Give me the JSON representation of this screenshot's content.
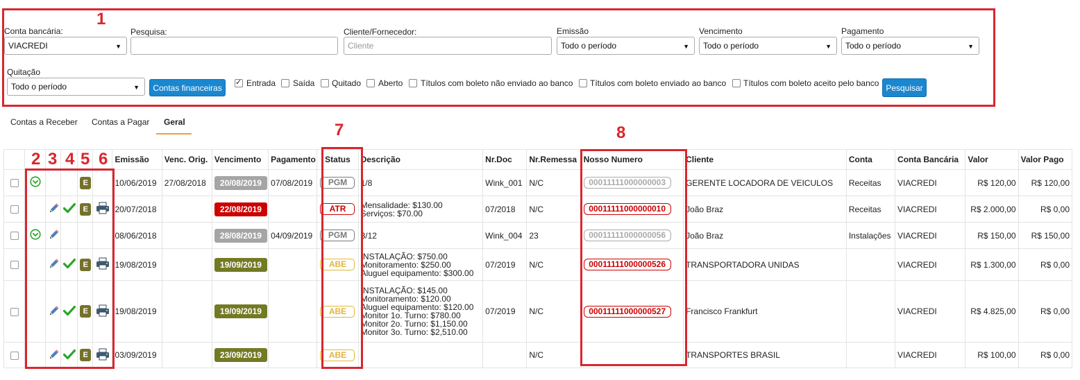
{
  "filters": {
    "conta_bancaria": {
      "label": "Conta bancária:",
      "value": "VIACREDI"
    },
    "pesquisa": {
      "label": "Pesquisa:",
      "value": ""
    },
    "cliente": {
      "label": "Cliente/Fornecedor:",
      "placeholder": "Cliente"
    },
    "emissao": {
      "label": "Emissão",
      "value": "Todo o período"
    },
    "vencimento": {
      "label": "Vencimento",
      "value": "Todo o período"
    },
    "pagamento": {
      "label": "Pagamento",
      "value": "Todo o período"
    },
    "quitacao": {
      "label": "Quitação",
      "value": "Todo o período"
    },
    "contas_financeiras_btn": "Contas financeiras",
    "checkboxes": [
      {
        "label": "Entrada",
        "checked": true
      },
      {
        "label": "Saída",
        "checked": false
      },
      {
        "label": "Quitado",
        "checked": false
      },
      {
        "label": "Aberto",
        "checked": false
      },
      {
        "label": "Títulos com boleto não enviado ao banco",
        "checked": false
      },
      {
        "label": "Títulos com boleto enviado ao banco",
        "checked": false
      },
      {
        "label": "Títulos com boleto aceito pelo banco",
        "checked": false
      }
    ],
    "pesquisar_btn": "Pesquisar"
  },
  "tabs": [
    {
      "label": "Contas a Receber",
      "active": false
    },
    {
      "label": "Contas a Pagar",
      "active": false
    },
    {
      "label": "Geral",
      "active": true
    }
  ],
  "table": {
    "headers": [
      "Emissão",
      "Venc. Orig.",
      "Vencimento",
      "Pagamento",
      "Status",
      "Descrição",
      "Nr.Doc",
      "Nr.Remessa",
      "Nosso Numero",
      "Cliente",
      "Conta",
      "Conta Bancária",
      "Valor",
      "Valor Pago"
    ],
    "rows": [
      {
        "icons": {
          "check_circle": true,
          "edit": false,
          "confirm": false,
          "e": true,
          "print": false
        },
        "emissao": "10/06/2019",
        "venc_orig": "27/08/2018",
        "vencimento": "20/08/2019",
        "venc_color": "#a5a5a5",
        "pagamento": "07/08/2019",
        "status": "PGM",
        "status_color": "#7a7a7a",
        "descricao": [
          "1/8"
        ],
        "nr_doc": "Wink_001",
        "nr_remessa": "N/C",
        "nosso": "00011111000000003",
        "nosso_color": "#aaaaaa",
        "cliente": "GERENTE LOCADORA DE VEICULOS",
        "conta": "Receitas",
        "conta_bancaria": "VIACREDI",
        "valor": "R$ 120,00",
        "valor_pago": "R$ 120,00"
      },
      {
        "icons": {
          "check_circle": false,
          "edit": true,
          "confirm": true,
          "e": true,
          "print": true
        },
        "emissao": "20/07/2018",
        "venc_orig": "",
        "vencimento": "22/08/2019",
        "venc_color": "#cc0000",
        "pagamento": "",
        "status": "ATR",
        "status_color": "#cc0000",
        "descricao": [
          "Mensalidade: $130.00",
          "Serviços: $70.00"
        ],
        "nr_doc": "07/2018",
        "nr_remessa": "N/C",
        "nosso": "00011111000000010",
        "nosso_color": "#cc0000",
        "cliente": "João Braz",
        "conta": "Receitas",
        "conta_bancaria": "VIACREDI",
        "valor": "R$ 2.000,00",
        "valor_pago": "R$ 0,00"
      },
      {
        "icons": {
          "check_circle": true,
          "edit": true,
          "confirm": false,
          "e": false,
          "print": false
        },
        "emissao": "08/06/2018",
        "venc_orig": "",
        "vencimento": "28/08/2019",
        "venc_color": "#a5a5a5",
        "pagamento": "04/09/2019",
        "status": "PGM",
        "status_color": "#7a7a7a",
        "descricao": [
          "3/12"
        ],
        "nr_doc": "Wink_004",
        "nr_remessa": "23",
        "nosso": "00011111000000056",
        "nosso_color": "#aaaaaa",
        "cliente": "João Braz",
        "conta": "Instalações",
        "conta_bancaria": "VIACREDI",
        "valor": "R$ 150,00",
        "valor_pago": "R$ 150,00"
      },
      {
        "icons": {
          "check_circle": false,
          "edit": true,
          "confirm": true,
          "e": true,
          "print": true
        },
        "emissao": "19/08/2019",
        "venc_orig": "",
        "vencimento": "19/09/2019",
        "venc_color": "#737a24",
        "pagamento": "",
        "status": "ABE",
        "status_color": "#e2b53a",
        "descricao": [
          "INSTALAÇÃO: $750.00",
          "Monitoramento: $250.00",
          "Aluguel equipamento: $300.00"
        ],
        "nr_doc": "07/2019",
        "nr_remessa": "N/C",
        "nosso": "00011111000000526",
        "nosso_color": "#cc0000",
        "cliente": "TRANSPORTADORA UNIDAS",
        "conta": "",
        "conta_bancaria": "VIACREDI",
        "valor": "R$ 1.300,00",
        "valor_pago": "R$ 0,00"
      },
      {
        "icons": {
          "check_circle": false,
          "edit": true,
          "confirm": true,
          "e": true,
          "print": true
        },
        "emissao": "19/08/2019",
        "venc_orig": "",
        "vencimento": "19/09/2019",
        "venc_color": "#737a24",
        "pagamento": "",
        "status": "ABE",
        "status_color": "#e2b53a",
        "descricao": [
          "INSTALAÇÃO: $145.00",
          "Monitoramento: $120.00",
          "Aluguel equipamento: $120.00",
          "Monitor 1o. Turno: $780.00",
          "Monitor 2o. Turno: $1,150.00",
          "Monitor 3o. Turno: $2,510.00"
        ],
        "nr_doc": "07/2019",
        "nr_remessa": "N/C",
        "nosso": "00011111000000527",
        "nosso_color": "#cc0000",
        "cliente": "Francisco Frankfurt",
        "conta": "",
        "conta_bancaria": "VIACREDI",
        "valor": "R$ 4.825,00",
        "valor_pago": "R$ 0,00"
      },
      {
        "icons": {
          "check_circle": false,
          "edit": true,
          "confirm": true,
          "e": true,
          "print": true
        },
        "emissao": "03/09/2019",
        "venc_orig": "",
        "vencimento": "23/09/2019",
        "venc_color": "#737a24",
        "pagamento": "",
        "status": "ABE",
        "status_color": "#e2b53a",
        "descricao": [],
        "nr_doc": "",
        "nr_remessa": "N/C",
        "nosso": "",
        "nosso_color": "#cc0000",
        "cliente": "TRANSPORTES BRASIL",
        "conta": "",
        "conta_bancaria": "VIACREDI",
        "valor": "R$ 100,00",
        "valor_pago": "R$ 0,00"
      }
    ]
  },
  "annotations": [
    "1",
    "2",
    "3",
    "4",
    "5",
    "6",
    "7",
    "8"
  ],
  "colors": {
    "annotation_red": "#d9262e",
    "button_blue": "#1a87cf",
    "tab_underline": "#e8a33b",
    "confirm_green": "#2aa52a",
    "edit_blue": "#4a7fc1"
  }
}
